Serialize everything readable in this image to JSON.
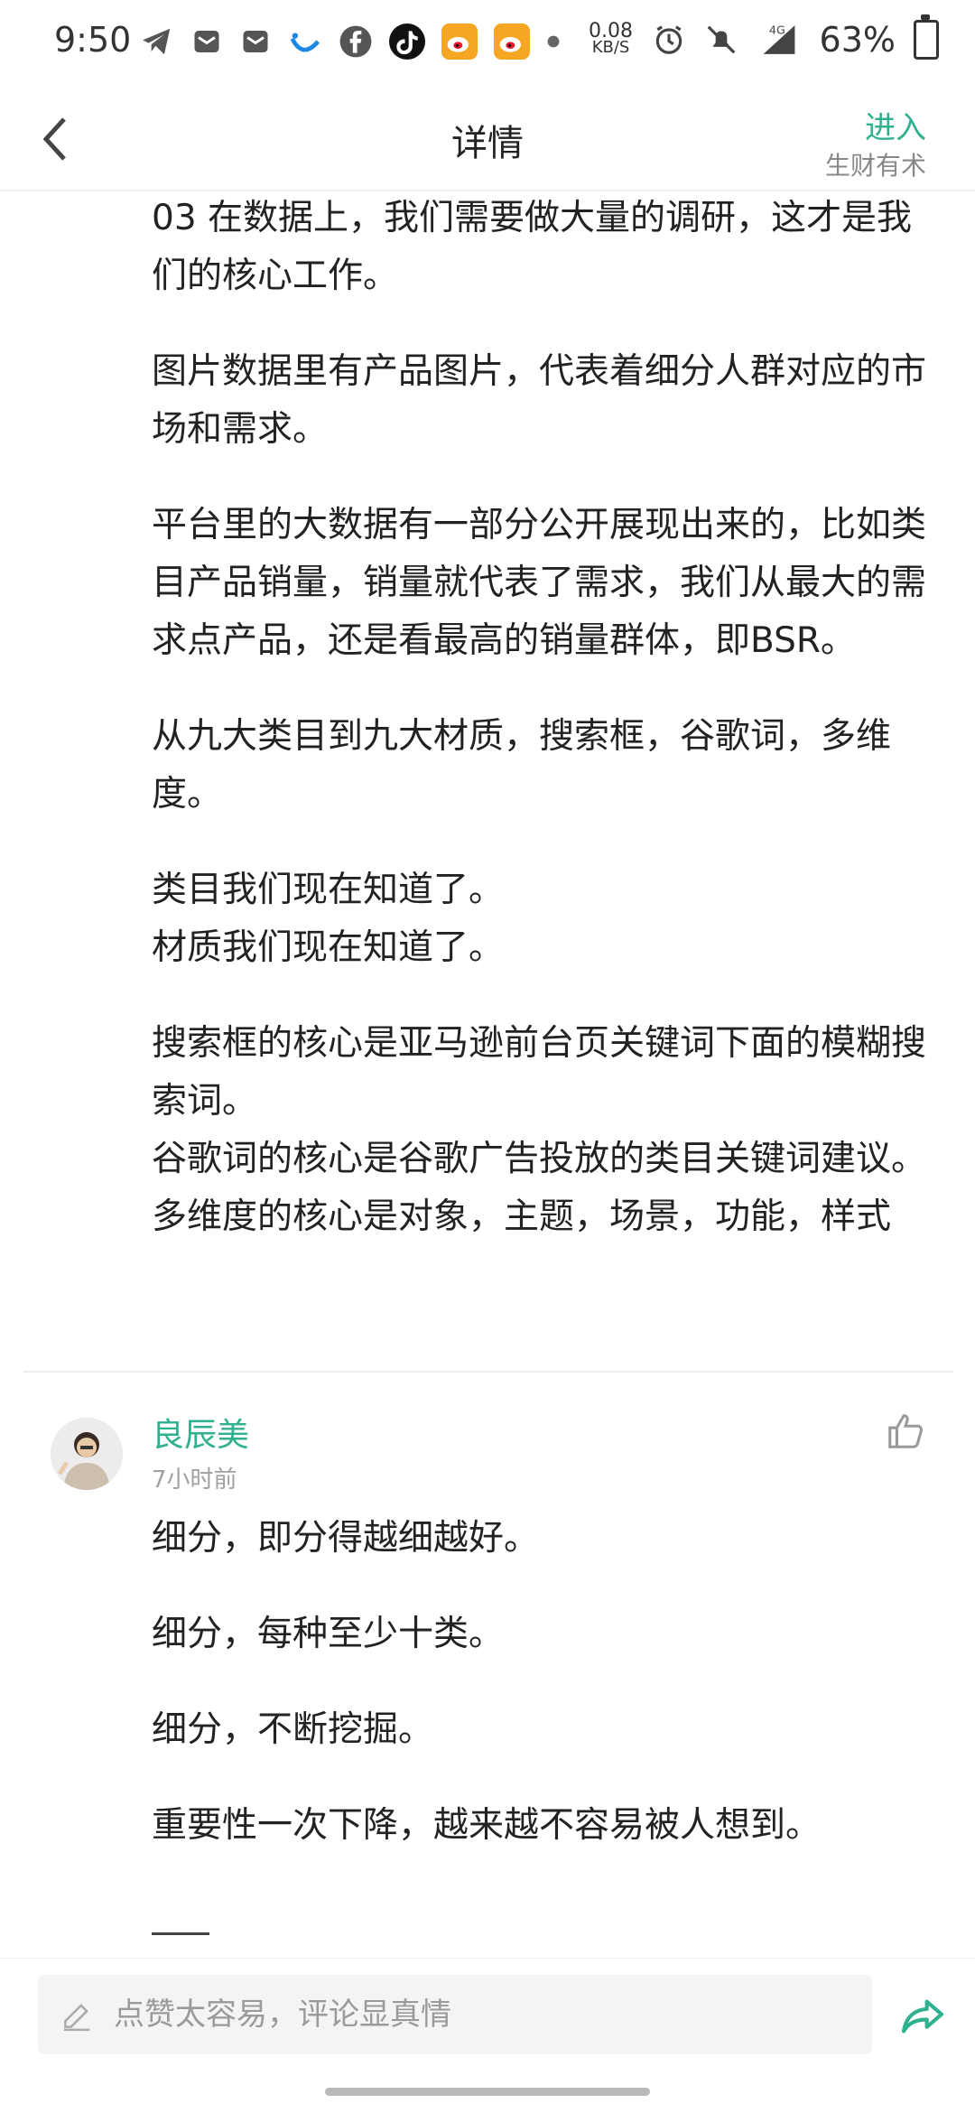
{
  "status_bar": {
    "time": "9:50",
    "net_speed": "0.08",
    "net_unit": "KB/S",
    "signal": "4G",
    "battery": "63%"
  },
  "header": {
    "title": "详情",
    "enter_label": "进入",
    "source": "生财有术"
  },
  "article": {
    "paragraphs": [
      "03  在数据上，我们需要做大量的调研，这才是我们的核心工作。",
      "图片数据里有产品图片，代表着细分人群对应的市场和需求。",
      "平台里的大数据有一部分公开展现出来的，比如类目产品销量，销量就代表了需求，我们从最大的需求点产品，还是看最高的销量群体，即BSR。",
      "从九大类目到九大材质，搜索框，谷歌词，多维度。",
      "类目我们现在知道了。",
      "材质我们现在知道了。",
      "搜索框的核心是亚马逊前台页关键词下面的模糊搜索词。",
      "谷歌词的核心是谷歌广告投放的类目关键词建议。",
      "多维度的核心是对象，主题，场景，功能，样式"
    ]
  },
  "comment": {
    "author": "良辰美",
    "time": "7小时前",
    "paragraphs": [
      "细分，即分得越细越好。",
      "细分，每种至少十类。",
      "细分，不断挖掘。",
      "重要性一次下降，越来越不容易被人想到。"
    ]
  },
  "bottom_bar": {
    "input_placeholder": "点赞太容易，评论显真情"
  },
  "icons": {
    "back": "chevron-left-icon",
    "like": "thumbs-up-icon",
    "edit": "pencil-icon",
    "share": "share-arrow-icon"
  },
  "colors": {
    "accent": "#2fb08f"
  }
}
